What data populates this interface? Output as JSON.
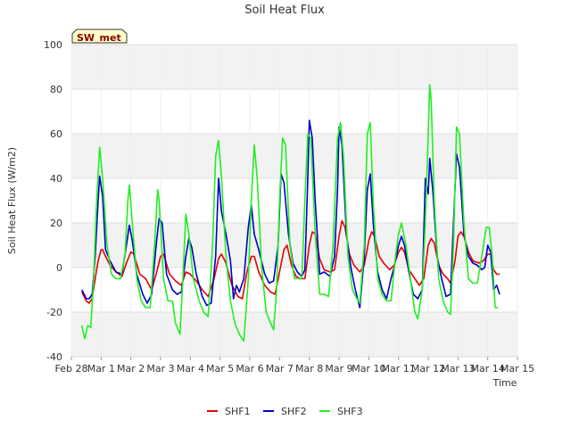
{
  "chart_data": {
    "type": "line",
    "title": "Soil Heat Flux",
    "xlabel": "Time",
    "ylabel": "Soil Heat Flux (W/m2)",
    "badge": "SW_met",
    "x_ticks": [
      "Feb 28",
      "Mar 1",
      "Mar 2",
      "Mar 3",
      "Mar 4",
      "Mar 5",
      "Mar 6",
      "Mar 7",
      "Mar 8",
      "Mar 9",
      "Mar 10",
      "Mar 11",
      "Mar 12",
      "Mar 13",
      "Mar 14",
      "Mar 15"
    ],
    "xlim": [
      0,
      15
    ],
    "ylim": [
      -40,
      100
    ],
    "y_ticks": [
      -40,
      -20,
      0,
      20,
      40,
      60,
      80,
      100
    ],
    "grid": true,
    "shaded_bands": true,
    "legend_position": "bottom-center",
    "series": [
      {
        "name": "SHF1",
        "color": "#e60000",
        "points": [
          [
            0.35,
            -11
          ],
          [
            0.5,
            -15
          ],
          [
            0.6,
            -16
          ],
          [
            0.7,
            -14
          ],
          [
            0.8,
            -5
          ],
          [
            0.9,
            3
          ],
          [
            1.0,
            8
          ],
          [
            1.05,
            8
          ],
          [
            1.15,
            5
          ],
          [
            1.3,
            1
          ],
          [
            1.5,
            -2
          ],
          [
            1.7,
            -4
          ],
          [
            1.85,
            2
          ],
          [
            2.0,
            7
          ],
          [
            2.1,
            6
          ],
          [
            2.3,
            -3
          ],
          [
            2.5,
            -5
          ],
          [
            2.7,
            -10
          ],
          [
            2.85,
            -3
          ],
          [
            3.0,
            5
          ],
          [
            3.1,
            6
          ],
          [
            3.3,
            -3
          ],
          [
            3.5,
            -6
          ],
          [
            3.7,
            -8
          ],
          [
            3.85,
            -2
          ],
          [
            4.0,
            -3
          ],
          [
            4.2,
            -6
          ],
          [
            4.4,
            -10
          ],
          [
            4.6,
            -13
          ],
          [
            4.8,
            -5
          ],
          [
            4.95,
            4
          ],
          [
            5.05,
            6
          ],
          [
            5.2,
            2
          ],
          [
            5.4,
            -8
          ],
          [
            5.6,
            -13
          ],
          [
            5.75,
            -14
          ],
          [
            5.9,
            -2
          ],
          [
            6.05,
            5
          ],
          [
            6.15,
            5
          ],
          [
            6.3,
            -2
          ],
          [
            6.5,
            -8
          ],
          [
            6.7,
            -11
          ],
          [
            6.85,
            -12
          ],
          [
            7.0,
            -2
          ],
          [
            7.15,
            8
          ],
          [
            7.25,
            10
          ],
          [
            7.4,
            1
          ],
          [
            7.55,
            -4
          ],
          [
            7.7,
            -5
          ],
          [
            7.85,
            -5
          ],
          [
            8.0,
            10
          ],
          [
            8.1,
            16
          ],
          [
            8.2,
            15
          ],
          [
            8.35,
            4
          ],
          [
            8.5,
            -1
          ],
          [
            8.7,
            -2
          ],
          [
            8.85,
            -1
          ],
          [
            9.0,
            14
          ],
          [
            9.1,
            21
          ],
          [
            9.2,
            18
          ],
          [
            9.35,
            6
          ],
          [
            9.5,
            1
          ],
          [
            9.7,
            -2
          ],
          [
            9.85,
            1
          ],
          [
            10.0,
            12
          ],
          [
            10.1,
            16
          ],
          [
            10.2,
            14
          ],
          [
            10.35,
            5
          ],
          [
            10.5,
            2
          ],
          [
            10.7,
            -1
          ],
          [
            10.85,
            1
          ],
          [
            11.0,
            7
          ],
          [
            11.1,
            9
          ],
          [
            11.2,
            7
          ],
          [
            11.35,
            -1
          ],
          [
            11.5,
            -4
          ],
          [
            11.7,
            -8
          ],
          [
            11.85,
            -5
          ],
          [
            12.0,
            10
          ],
          [
            12.1,
            13
          ],
          [
            12.2,
            11
          ],
          [
            12.35,
            1
          ],
          [
            12.5,
            -3
          ],
          [
            12.65,
            -5
          ],
          [
            12.75,
            -7
          ],
          [
            12.9,
            3
          ],
          [
            13.0,
            14
          ],
          [
            13.1,
            16
          ],
          [
            13.2,
            14
          ],
          [
            13.35,
            7
          ],
          [
            13.5,
            3
          ],
          [
            13.7,
            2
          ],
          [
            13.85,
            3
          ],
          [
            14.0,
            6
          ],
          [
            14.1,
            6
          ],
          [
            14.2,
            -1
          ],
          [
            14.3,
            -3
          ],
          [
            14.4,
            -3
          ]
        ]
      },
      {
        "name": "SHF2",
        "color": "#0000cc",
        "points": [
          [
            0.35,
            -10
          ],
          [
            0.5,
            -14
          ],
          [
            0.6,
            -14
          ],
          [
            0.7,
            -12
          ],
          [
            0.8,
            5
          ],
          [
            0.9,
            30
          ],
          [
            0.95,
            41
          ],
          [
            1.05,
            32
          ],
          [
            1.15,
            8
          ],
          [
            1.3,
            3
          ],
          [
            1.5,
            -2
          ],
          [
            1.7,
            -3
          ],
          [
            1.85,
            10
          ],
          [
            1.95,
            19
          ],
          [
            2.05,
            12
          ],
          [
            2.2,
            -3
          ],
          [
            2.4,
            -12
          ],
          [
            2.55,
            -16
          ],
          [
            2.7,
            -12
          ],
          [
            2.85,
            10
          ],
          [
            2.95,
            22
          ],
          [
            3.05,
            20
          ],
          [
            3.2,
            -3
          ],
          [
            3.4,
            -10
          ],
          [
            3.55,
            -12
          ],
          [
            3.7,
            -11
          ],
          [
            3.85,
            5
          ],
          [
            3.95,
            13
          ],
          [
            4.05,
            9
          ],
          [
            4.2,
            -3
          ],
          [
            4.4,
            -13
          ],
          [
            4.55,
            -17
          ],
          [
            4.7,
            -16
          ],
          [
            4.85,
            5
          ],
          [
            4.95,
            40
          ],
          [
            5.05,
            25
          ],
          [
            5.2,
            15
          ],
          [
            5.35,
            3
          ],
          [
            5.45,
            -14
          ],
          [
            5.55,
            -8
          ],
          [
            5.65,
            -11
          ],
          [
            5.8,
            -5
          ],
          [
            5.95,
            18
          ],
          [
            6.05,
            28
          ],
          [
            6.15,
            15
          ],
          [
            6.3,
            8
          ],
          [
            6.5,
            -3
          ],
          [
            6.65,
            -7
          ],
          [
            6.8,
            -6
          ],
          [
            6.95,
            10
          ],
          [
            7.05,
            42
          ],
          [
            7.15,
            38
          ],
          [
            7.3,
            15
          ],
          [
            7.45,
            2
          ],
          [
            7.6,
            -2
          ],
          [
            7.75,
            -4
          ],
          [
            7.85,
            -1
          ],
          [
            7.95,
            40
          ],
          [
            8.0,
            66
          ],
          [
            8.1,
            58
          ],
          [
            8.2,
            30
          ],
          [
            8.35,
            -3
          ],
          [
            8.5,
            -2
          ],
          [
            8.7,
            -4
          ],
          [
            8.85,
            5
          ],
          [
            8.95,
            35
          ],
          [
            9.0,
            63
          ],
          [
            9.1,
            55
          ],
          [
            9.25,
            15
          ],
          [
            9.4,
            0
          ],
          [
            9.55,
            -10
          ],
          [
            9.7,
            -18
          ],
          [
            9.85,
            5
          ],
          [
            9.95,
            35
          ],
          [
            10.05,
            42
          ],
          [
            10.15,
            20
          ],
          [
            10.3,
            -2
          ],
          [
            10.45,
            -10
          ],
          [
            10.6,
            -14
          ],
          [
            10.75,
            -5
          ],
          [
            10.85,
            0
          ],
          [
            11.0,
            10
          ],
          [
            11.1,
            14
          ],
          [
            11.2,
            10
          ],
          [
            11.35,
            -2
          ],
          [
            11.5,
            -12
          ],
          [
            11.65,
            -14
          ],
          [
            11.8,
            -10
          ],
          [
            11.9,
            40
          ],
          [
            12.0,
            33
          ],
          [
            12.05,
            49
          ],
          [
            12.15,
            35
          ],
          [
            12.3,
            5
          ],
          [
            12.45,
            -5
          ],
          [
            12.6,
            -13
          ],
          [
            12.75,
            -12
          ],
          [
            12.85,
            20
          ],
          [
            12.95,
            51
          ],
          [
            13.05,
            45
          ],
          [
            13.2,
            15
          ],
          [
            13.35,
            5
          ],
          [
            13.5,
            2
          ],
          [
            13.65,
            1
          ],
          [
            13.8,
            -1
          ],
          [
            13.9,
            0
          ],
          [
            14.0,
            10
          ],
          [
            14.1,
            7
          ],
          [
            14.2,
            -10
          ],
          [
            14.3,
            -8
          ],
          [
            14.4,
            -12
          ]
        ]
      },
      {
        "name": "SHF3",
        "color": "#22ee22",
        "points": [
          [
            0.35,
            -26
          ],
          [
            0.45,
            -32
          ],
          [
            0.55,
            -26
          ],
          [
            0.65,
            -27
          ],
          [
            0.75,
            -5
          ],
          [
            0.85,
            30
          ],
          [
            0.95,
            54
          ],
          [
            1.05,
            40
          ],
          [
            1.2,
            10
          ],
          [
            1.35,
            -3
          ],
          [
            1.5,
            -5
          ],
          [
            1.65,
            -5
          ],
          [
            1.8,
            5
          ],
          [
            1.9,
            30
          ],
          [
            1.95,
            37
          ],
          [
            2.05,
            20
          ],
          [
            2.2,
            -5
          ],
          [
            2.35,
            -15
          ],
          [
            2.5,
            -18
          ],
          [
            2.65,
            -18
          ],
          [
            2.8,
            10
          ],
          [
            2.9,
            35
          ],
          [
            2.95,
            30
          ],
          [
            3.1,
            -5
          ],
          [
            3.25,
            -15
          ],
          [
            3.4,
            -15
          ],
          [
            3.5,
            -25
          ],
          [
            3.65,
            -30
          ],
          [
            3.75,
            -5
          ],
          [
            3.85,
            24
          ],
          [
            3.95,
            15
          ],
          [
            4.1,
            -5
          ],
          [
            4.3,
            -15
          ],
          [
            4.45,
            -20
          ],
          [
            4.6,
            -22
          ],
          [
            4.75,
            10
          ],
          [
            4.85,
            50
          ],
          [
            4.95,
            57
          ],
          [
            5.05,
            40
          ],
          [
            5.2,
            5
          ],
          [
            5.35,
            -15
          ],
          [
            5.5,
            -25
          ],
          [
            5.65,
            -30
          ],
          [
            5.8,
            -33
          ],
          [
            5.95,
            -5
          ],
          [
            6.05,
            30
          ],
          [
            6.15,
            55
          ],
          [
            6.25,
            40
          ],
          [
            6.4,
            0
          ],
          [
            6.55,
            -20
          ],
          [
            6.7,
            -25
          ],
          [
            6.8,
            -28
          ],
          [
            6.9,
            -10
          ],
          [
            7.0,
            30
          ],
          [
            7.1,
            58
          ],
          [
            7.2,
            55
          ],
          [
            7.35,
            10
          ],
          [
            7.5,
            -5
          ],
          [
            7.65,
            -5
          ],
          [
            7.75,
            -5
          ],
          [
            7.85,
            30
          ],
          [
            7.95,
            60
          ],
          [
            8.05,
            58
          ],
          [
            8.2,
            15
          ],
          [
            8.35,
            -12
          ],
          [
            8.5,
            -12
          ],
          [
            8.65,
            -13
          ],
          [
            8.8,
            10
          ],
          [
            8.95,
            58
          ],
          [
            9.05,
            65
          ],
          [
            9.15,
            50
          ],
          [
            9.3,
            5
          ],
          [
            9.45,
            -10
          ],
          [
            9.6,
            -14
          ],
          [
            9.7,
            -16
          ],
          [
            9.85,
            10
          ],
          [
            9.95,
            60
          ],
          [
            10.05,
            65
          ],
          [
            10.15,
            30
          ],
          [
            10.3,
            -5
          ],
          [
            10.45,
            -12
          ],
          [
            10.6,
            -15
          ],
          [
            10.75,
            -15
          ],
          [
            10.9,
            5
          ],
          [
            11.0,
            15
          ],
          [
            11.1,
            20
          ],
          [
            11.25,
            10
          ],
          [
            11.4,
            -5
          ],
          [
            11.55,
            -20
          ],
          [
            11.65,
            -23
          ],
          [
            11.8,
            -10
          ],
          [
            11.9,
            20
          ],
          [
            12.0,
            60
          ],
          [
            12.05,
            82
          ],
          [
            12.1,
            75
          ],
          [
            12.2,
            30
          ],
          [
            12.35,
            -5
          ],
          [
            12.5,
            -15
          ],
          [
            12.65,
            -20
          ],
          [
            12.75,
            -21
          ],
          [
            12.85,
            10
          ],
          [
            12.95,
            63
          ],
          [
            13.05,
            60
          ],
          [
            13.2,
            20
          ],
          [
            13.35,
            -5
          ],
          [
            13.5,
            -7
          ],
          [
            13.65,
            -7
          ],
          [
            13.8,
            5
          ],
          [
            13.95,
            18
          ],
          [
            14.05,
            18
          ],
          [
            14.15,
            5
          ],
          [
            14.25,
            -18
          ],
          [
            14.35,
            -18
          ]
        ]
      }
    ]
  }
}
